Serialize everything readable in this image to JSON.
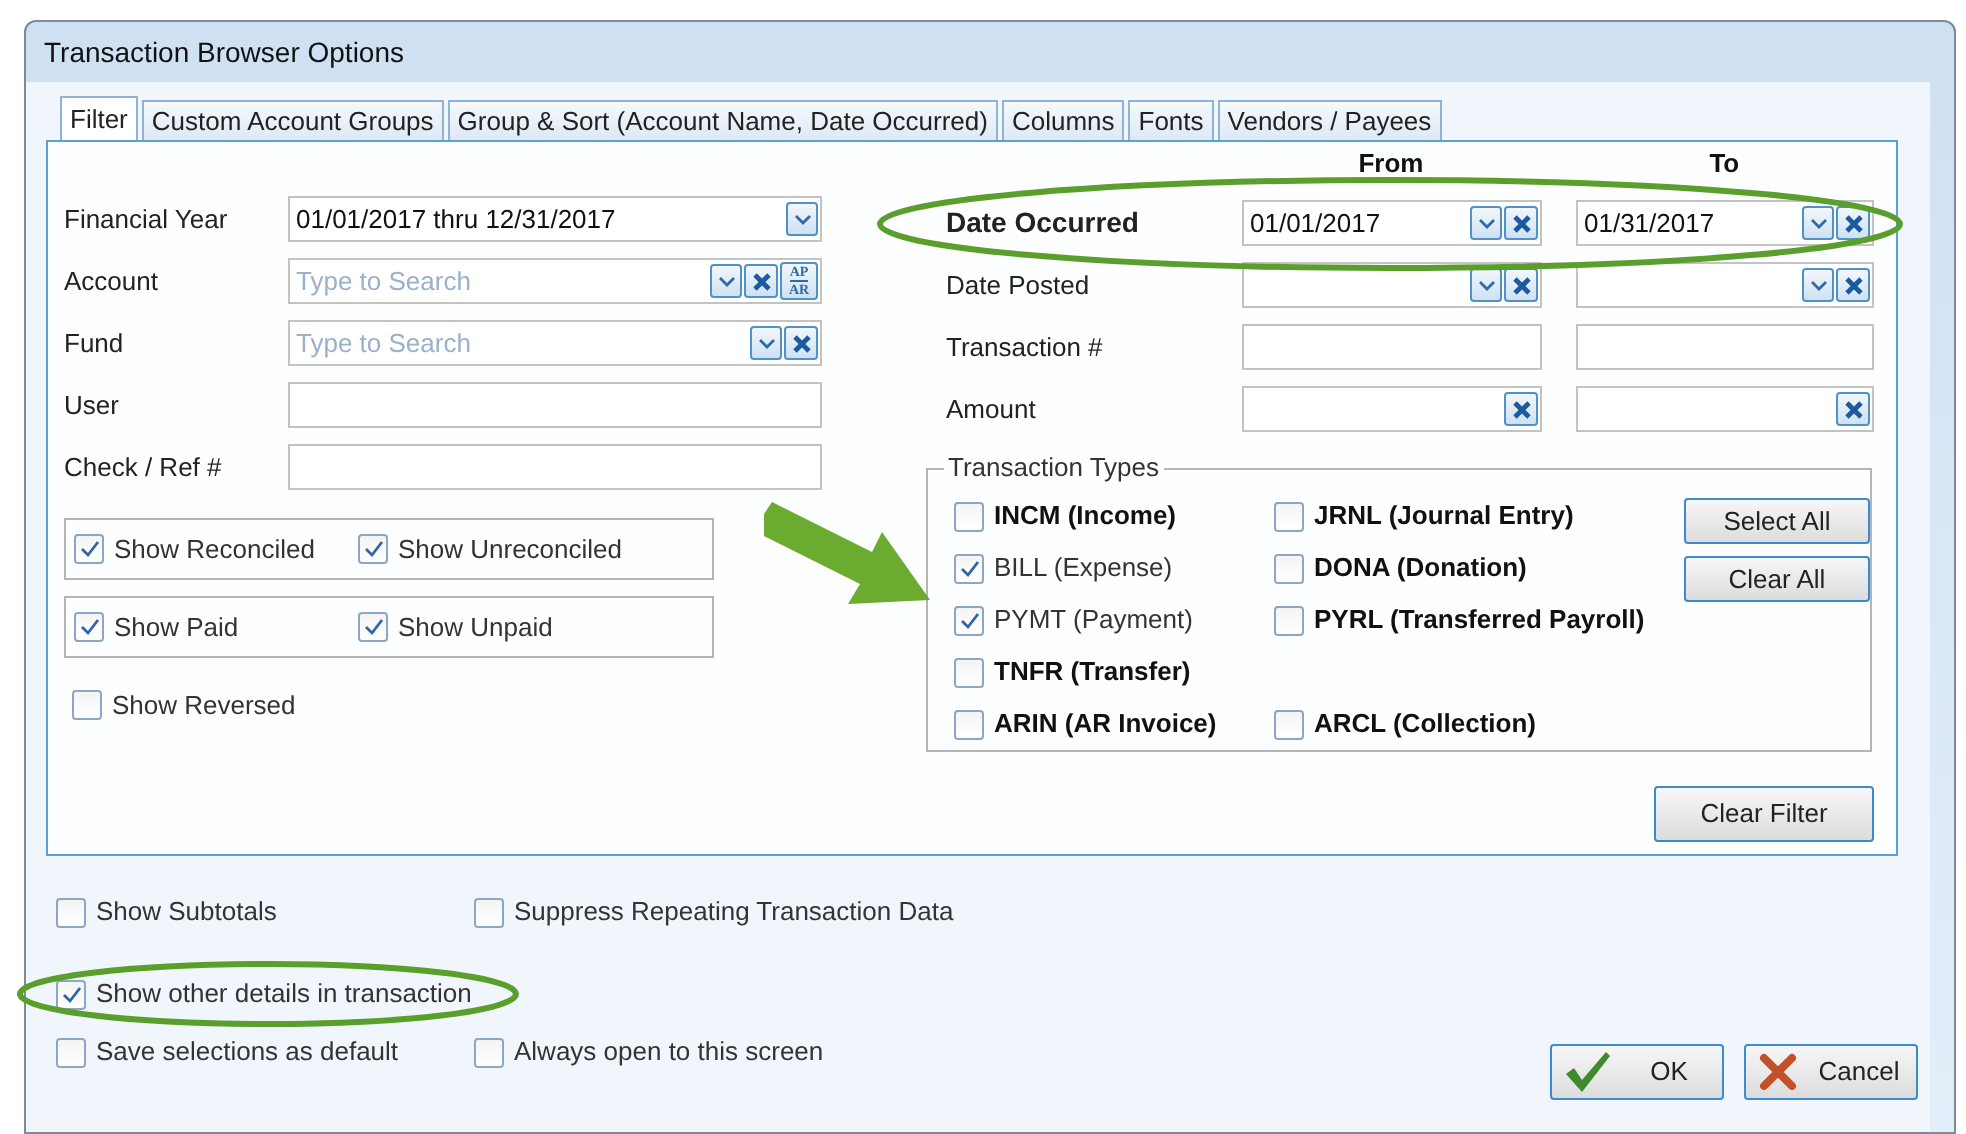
{
  "window": {
    "title": "Transaction Browser Options"
  },
  "tabs": [
    {
      "label": "Filter",
      "selected": true
    },
    {
      "label": "Custom Account Groups",
      "selected": false
    },
    {
      "label": "Group & Sort (Account Name, Date Occurred)",
      "selected": false
    },
    {
      "label": "Columns",
      "selected": false
    },
    {
      "label": "Fonts",
      "selected": false
    },
    {
      "label": "Vendors / Payees",
      "selected": false
    }
  ],
  "left_fields": [
    {
      "label": "Financial Year",
      "value": "01/01/2017 thru 12/31/2017",
      "buttons": [
        {
          "kind": "dropdown"
        }
      ]
    },
    {
      "label": "Account",
      "placeholder": "Type to Search",
      "buttons": [
        {
          "kind": "dropdown"
        },
        {
          "kind": "clear"
        },
        {
          "kind": "ledger",
          "top": "AP",
          "bottom": "AR"
        }
      ]
    },
    {
      "label": "Fund",
      "placeholder": "Type to Search",
      "buttons": [
        {
          "kind": "dropdown"
        },
        {
          "kind": "clear"
        }
      ]
    },
    {
      "label": "User"
    },
    {
      "label": "Check / Ref #"
    }
  ],
  "check_groups": [
    {
      "boxed": true,
      "items": [
        {
          "label": "Show Reconciled",
          "checked": true
        },
        {
          "label": "Show Unreconciled",
          "checked": true
        }
      ]
    },
    {
      "boxed": true,
      "items": [
        {
          "label": "Show Paid",
          "checked": true
        },
        {
          "label": "Show Unpaid",
          "checked": true
        }
      ]
    },
    {
      "boxed": false,
      "items": [
        {
          "label": "Show Reversed",
          "checked": false
        }
      ]
    }
  ],
  "range_headers": {
    "from": "From",
    "to": "To"
  },
  "range_fields": [
    {
      "label": "Date Occurred",
      "emphasized": true,
      "from": {
        "value": "01/01/2017",
        "buttons": [
          {
            "kind": "dropdown"
          },
          {
            "kind": "clear"
          }
        ]
      },
      "to": {
        "value": "01/31/2017",
        "buttons": [
          {
            "kind": "dropdown"
          },
          {
            "kind": "clear"
          }
        ]
      }
    },
    {
      "label": "Date Posted",
      "emphasized": false,
      "from": {
        "buttons": [
          {
            "kind": "dropdown"
          },
          {
            "kind": "clear"
          }
        ]
      },
      "to": {
        "buttons": [
          {
            "kind": "dropdown"
          },
          {
            "kind": "clear"
          }
        ]
      }
    },
    {
      "label": "Transaction #",
      "emphasized": false
    },
    {
      "label": "Amount",
      "emphasized": false,
      "from": {
        "buttons": [
          {
            "kind": "clear"
          }
        ]
      },
      "to": {
        "buttons": [
          {
            "kind": "clear"
          }
        ]
      }
    }
  ],
  "transaction_types": {
    "title": "Transaction Types",
    "rows": [
      [
        {
          "label": "INCM (Income)",
          "checked": false
        },
        {
          "label": "JRNL (Journal Entry)",
          "checked": false
        }
      ],
      [
        {
          "label": "BILL (Expense)",
          "checked": true
        },
        {
          "label": "DONA (Donation)",
          "checked": false
        }
      ],
      [
        {
          "label": "PYMT (Payment)",
          "checked": true
        },
        {
          "label": "PYRL (Transferred Payroll)",
          "checked": false
        }
      ],
      [
        {
          "label": "TNFR (Transfer)",
          "checked": false
        }
      ],
      [
        {
          "label": "ARIN (AR Invoice)",
          "checked": false
        },
        {
          "label": "ARCL (Collection)",
          "checked": false
        }
      ]
    ],
    "buttons": [
      "Select All",
      "Clear All"
    ]
  },
  "clear_filter_button": "Clear Filter",
  "bottom_options": [
    [
      {
        "label": "Show Subtotals",
        "checked": false
      },
      {
        "label": "Suppress Repeating Transaction Data",
        "checked": false
      }
    ],
    [
      {
        "label": "Show other details in transaction",
        "checked": true
      }
    ],
    [
      {
        "label": "Save selections as default",
        "checked": false
      },
      {
        "label": "Always open to this screen",
        "checked": false
      }
    ]
  ],
  "actions": [
    {
      "kind": "ok",
      "label": "OK"
    },
    {
      "kind": "cancel",
      "label": "Cancel"
    }
  ]
}
